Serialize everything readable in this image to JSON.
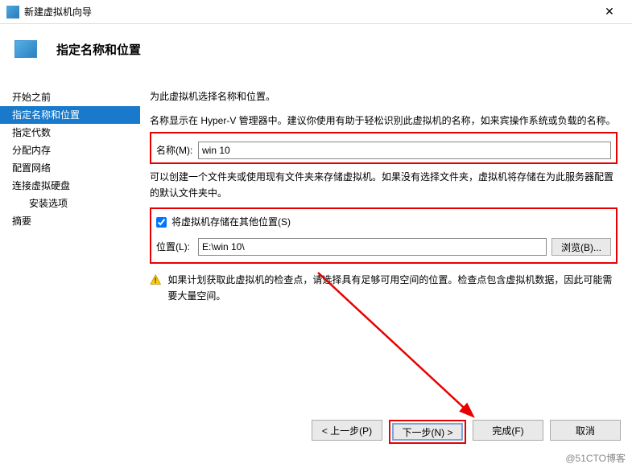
{
  "window": {
    "title": "新建虚拟机向导"
  },
  "header": {
    "title": "指定名称和位置"
  },
  "sidebar": {
    "items": [
      {
        "label": "开始之前"
      },
      {
        "label": "指定名称和位置"
      },
      {
        "label": "指定代数"
      },
      {
        "label": "分配内存"
      },
      {
        "label": "配置网络"
      },
      {
        "label": "连接虚拟硬盘"
      },
      {
        "label": "安装选项"
      },
      {
        "label": "摘要"
      }
    ]
  },
  "main": {
    "intro1": "为此虚拟机选择名称和位置。",
    "intro2": "名称显示在 Hyper-V 管理器中。建议你使用有助于轻松识别此虚拟机的名称，如来宾操作系统或负载的名称。",
    "name_label": "名称(M):",
    "name_value": "win 10",
    "folder_note": "可以创建一个文件夹或使用现有文件夹来存储虚拟机。如果没有选择文件夹，虚拟机将存储在为此服务器配置的默认文件夹中。",
    "store_checkbox": "将虚拟机存储在其他位置(S)",
    "location_label": "位置(L):",
    "location_value": "E:\\win 10\\",
    "browse_label": "浏览(B)...",
    "warning": "如果计划获取此虚拟机的检查点，请选择具有足够可用空间的位置。检查点包含虚拟机数据，因此可能需要大量空间。"
  },
  "footer": {
    "prev": "< 上一步(P)",
    "next": "下一步(N) >",
    "finish": "完成(F)",
    "cancel": "取消"
  },
  "watermark": "@51CTO博客"
}
